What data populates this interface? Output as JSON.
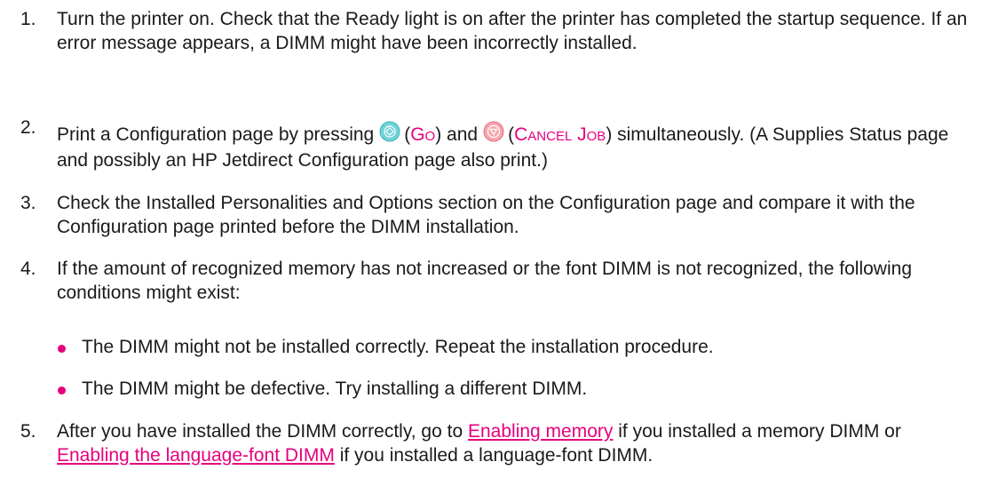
{
  "steps": [
    {
      "num": "1.",
      "text": "Turn the printer on. Check that the Ready light is on after the printer has completed the startup sequence. If an error message appears, a DIMM might have been incorrectly installed."
    },
    {
      "num": "2.",
      "part1": "Print a Configuration page by pressing",
      "key1_open": "(",
      "key1": "Go",
      "key1_close": ") and",
      "key2_open": "(",
      "key2": "Cancel Job",
      "key2_close": ") simultaneously. (A Supplies Status page and possibly an HP Jetdirect Configuration page also print.)"
    },
    {
      "num": "3.",
      "text": "Check the Installed Personalities and Options section on the Configuration page and compare it with the Configuration page printed before the DIMM installation."
    },
    {
      "num": "4.",
      "text": "If the amount of recognized memory has not increased or the font DIMM is not recognized, the following conditions might exist:",
      "bullets": [
        "The DIMM might not be installed correctly. Repeat the installation procedure.",
        "The DIMM might be defective. Try installing a different DIMM."
      ]
    },
    {
      "num": "5.",
      "part1": "After you have installed the DIMM correctly, go to",
      "link1": "Enabling memory",
      "part2": "if you installed a memory DIMM or",
      "link2": "Enabling the language-font DIMM",
      "part3": "if you installed a language-font DIMM."
    }
  ],
  "icons": {
    "go": "go-button-icon",
    "cancel": "cancel-job-button-icon"
  },
  "colors": {
    "accent": "#e5007e",
    "go_button": "#6fd3d6",
    "cancel_button": "#f7a6b0"
  }
}
